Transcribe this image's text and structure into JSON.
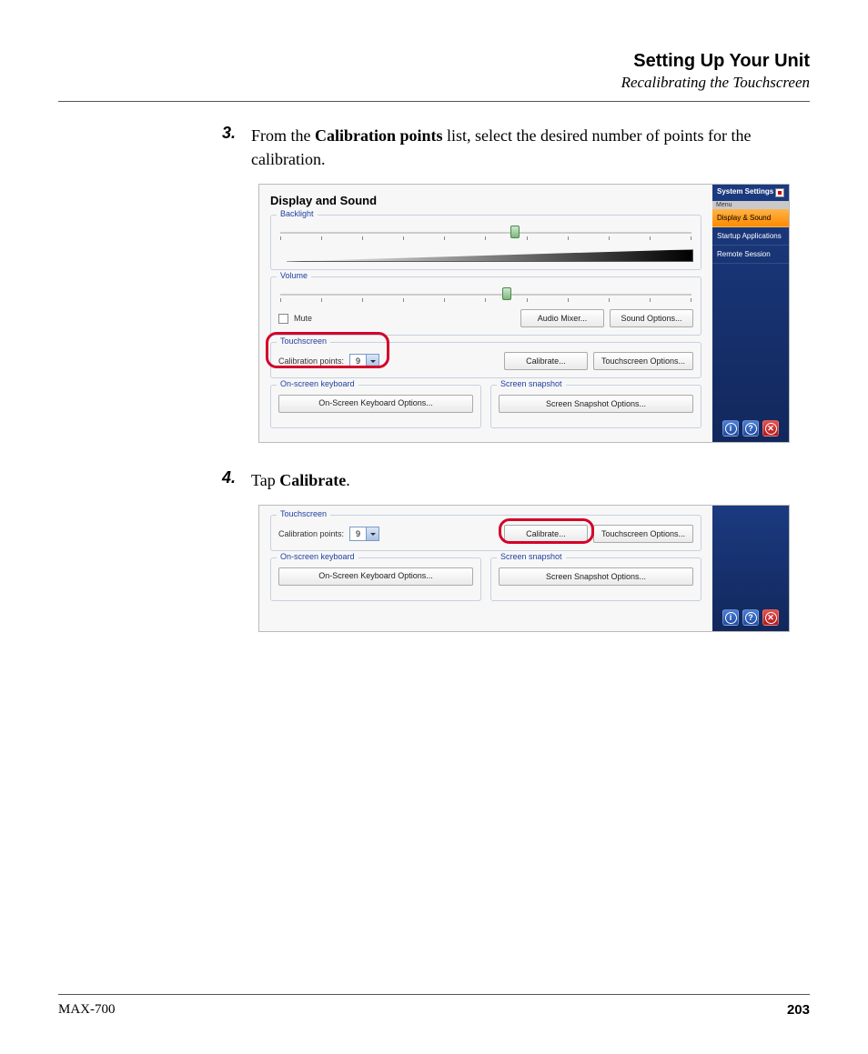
{
  "header": {
    "title": "Setting Up Your Unit",
    "subtitle": "Recalibrating the Touchscreen"
  },
  "steps": {
    "s3": {
      "num": "3.",
      "pre": "From the ",
      "bold1": "Calibration points",
      "post": " list, select the desired number of points for the calibration."
    },
    "s4": {
      "num": "4.",
      "pre": "Tap ",
      "bold1": "Calibrate",
      "post": "."
    }
  },
  "shot1": {
    "panel_title": "Display and Sound",
    "backlight_legend": "Backlight",
    "volume_legend": "Volume",
    "mute_label": "Mute",
    "audio_mixer_btn": "Audio Mixer...",
    "sound_options_btn": "Sound Options...",
    "touchscreen_legend": "Touchscreen",
    "calib_label": "Calibration points:",
    "calib_value": "9",
    "calibrate_btn": "Calibrate...",
    "touch_options_btn": "Touchscreen Options...",
    "osk_legend": "On-screen keyboard",
    "osk_btn": "On-Screen Keyboard Options...",
    "snap_legend": "Screen snapshot",
    "snap_btn": "Screen Snapshot Options...",
    "sidebar": {
      "title": "System Settings",
      "menu_label": "Menu",
      "items": [
        "Display & Sound",
        "Startup Applications",
        "Remote Session"
      ]
    }
  },
  "shot2": {
    "touchscreen_legend": "Touchscreen",
    "calib_label": "Calibration points:",
    "calib_value": "9",
    "calibrate_btn": "Calibrate...",
    "touch_options_btn": "Touchscreen Options...",
    "osk_legend": "On-screen keyboard",
    "osk_btn": "On-Screen Keyboard Options...",
    "snap_legend": "Screen snapshot",
    "snap_btn": "Screen Snapshot Options..."
  },
  "footer": {
    "model": "MAX-700",
    "page": "203"
  }
}
